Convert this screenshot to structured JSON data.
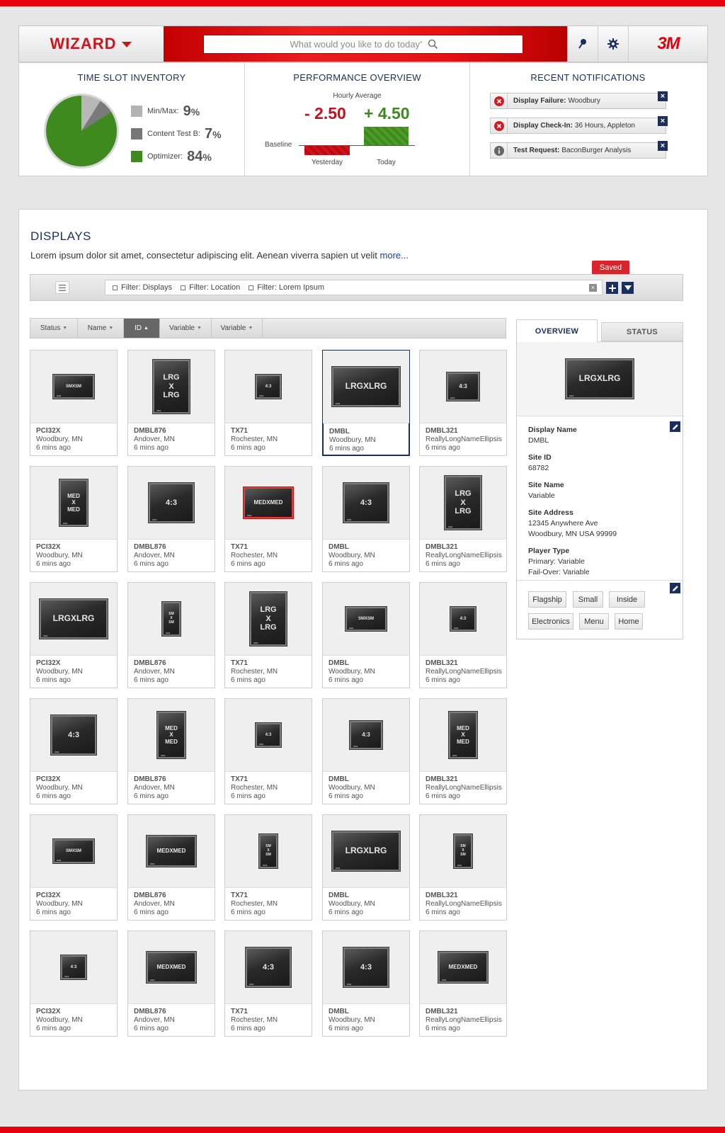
{
  "header": {
    "wizard_label": "WIZARD",
    "search_placeholder": "What would you like to do today?",
    "logo": "3M"
  },
  "time_slot": {
    "title": "TIME SLOT INVENTORY",
    "items": [
      {
        "label": "Min/Max:",
        "value": "9",
        "unit": "%",
        "color": "#b3b3b3"
      },
      {
        "label": "Content Test B:",
        "value": "7",
        "unit": "%",
        "color": "#777777"
      },
      {
        "label": "Optimizer:",
        "value": "84",
        "unit": "%",
        "color": "#3f8a1f"
      }
    ]
  },
  "performance": {
    "title": "PERFORMANCE OVERVIEW",
    "subtitle": "Hourly Average",
    "yesterday_value": "- 2.50",
    "today_value": "+ 4.50",
    "baseline_label": "Baseline",
    "yesterday_label": "Yesterday",
    "today_label": "Today"
  },
  "notifications": {
    "title": "RECENT NOTIFICATIONS",
    "items": [
      {
        "icon": "error-icon",
        "bold": "Display Failure:",
        "text": "Woodbury"
      },
      {
        "icon": "error-icon",
        "bold": "Display Check-In:",
        "text": "36 Hours, Appleton"
      },
      {
        "icon": "info-icon",
        "bold": "Test Request:",
        "text": "BaconBurger  Analysis"
      }
    ]
  },
  "displays": {
    "title": "DISPLAYS",
    "description": "Lorem ipsum dolor sit amet, consectetur adipiscing elit. Aenean viverra sapien ut velit",
    "more_link": "more...",
    "saved_tooltip": "Saved",
    "filters": [
      "Filter: Displays",
      "Filter: Location",
      "Filter: Lorem Ipsum"
    ],
    "sort_columns": [
      {
        "label": "Status",
        "arrow": "▼",
        "active": false
      },
      {
        "label": "Name",
        "arrow": "▼",
        "active": false
      },
      {
        "label": "ID",
        "arrow": "▲",
        "active": true
      },
      {
        "label": "Variable",
        "arrow": "▼",
        "active": false
      },
      {
        "label": "Variable",
        "arrow": "▼",
        "active": false
      }
    ],
    "columns": [
      {
        "name": "PCI32X",
        "location": "Woodbury, MN"
      },
      {
        "name": "DMBL876",
        "location": "Andover, MN"
      },
      {
        "name": "TX71",
        "location": "Rochester, MN"
      },
      {
        "name": "DMBL",
        "location": "Woodbury, MN"
      },
      {
        "name": "DMBL321",
        "location": "ReallyLongNameEllipsis"
      }
    ],
    "time": "6 mins ago",
    "rows": [
      [
        {
          "screen": "SMXSM",
          "shape": "sm-l"
        },
        {
          "screen": "LRG\nX\nLRG",
          "shape": "lg-p"
        },
        {
          "screen": "4:3",
          "shape": "sq-s"
        },
        {
          "screen": "LRGXLRG",
          "shape": "lg-l",
          "selected": true
        },
        {
          "screen": "4:3",
          "shape": "sq-m"
        }
      ],
      [
        {
          "screen": "MED\nX\nMED",
          "shape": "md-p"
        },
        {
          "screen": "4:3",
          "shape": "sq-l"
        },
        {
          "screen": "MEDXMED",
          "shape": "md-l",
          "red": true
        },
        {
          "screen": "4:3",
          "shape": "sq-l"
        },
        {
          "screen": "LRG\nX\nLRG",
          "shape": "lg-p"
        }
      ],
      [
        {
          "screen": "LRGXLRG",
          "shape": "lg-l"
        },
        {
          "screen": "SM\nX\nSM",
          "shape": "sm-p"
        },
        {
          "screen": "LRG\nX\nLRG",
          "shape": "lg-p"
        },
        {
          "screen": "SMXSM",
          "shape": "sm-l"
        },
        {
          "screen": "4:3",
          "shape": "sq-s"
        }
      ],
      [
        {
          "screen": "4:3",
          "shape": "sq-l"
        },
        {
          "screen": "MED\nX\nMED",
          "shape": "md-p"
        },
        {
          "screen": "4:3",
          "shape": "sq-s"
        },
        {
          "screen": "4:3",
          "shape": "sq-m"
        },
        {
          "screen": "MED\nX\nMED",
          "shape": "md-p"
        }
      ],
      [
        {
          "screen": "SMXSM",
          "shape": "sm-l"
        },
        {
          "screen": "MEDXMED",
          "shape": "md-l"
        },
        {
          "screen": "SM\nX\nSM",
          "shape": "sm-p"
        },
        {
          "screen": "LRGXLRG",
          "shape": "lg-l"
        },
        {
          "screen": "SM\nX\nSM",
          "shape": "sm-p"
        }
      ],
      [
        {
          "screen": "4:3",
          "shape": "sq-s"
        },
        {
          "screen": "MEDXMED",
          "shape": "md-l"
        },
        {
          "screen": "4:3",
          "shape": "sq-l"
        },
        {
          "screen": "4:3",
          "shape": "sq-l"
        },
        {
          "screen": "MEDXMED",
          "shape": "md-l"
        }
      ]
    ]
  },
  "side_panel": {
    "tab_overview": "OVERVIEW",
    "tab_status": "STATUS",
    "preview_screen": "LRGXLRG",
    "fields": [
      {
        "label": "Display Name",
        "value": "DMBL"
      },
      {
        "label": "Site ID",
        "value": "68782"
      },
      {
        "label": "Site Name",
        "value": "Variable"
      },
      {
        "label": "Site Address",
        "value": "12345 Anywhere Ave\nWoodbury, MN USA 99999"
      },
      {
        "label": "Player Type",
        "value": "Primary: Variable\nFail-Over: Variable"
      }
    ],
    "tags": [
      "Flagship",
      "Small",
      "Inside",
      "Electronics",
      "Menu",
      "Home"
    ]
  }
}
